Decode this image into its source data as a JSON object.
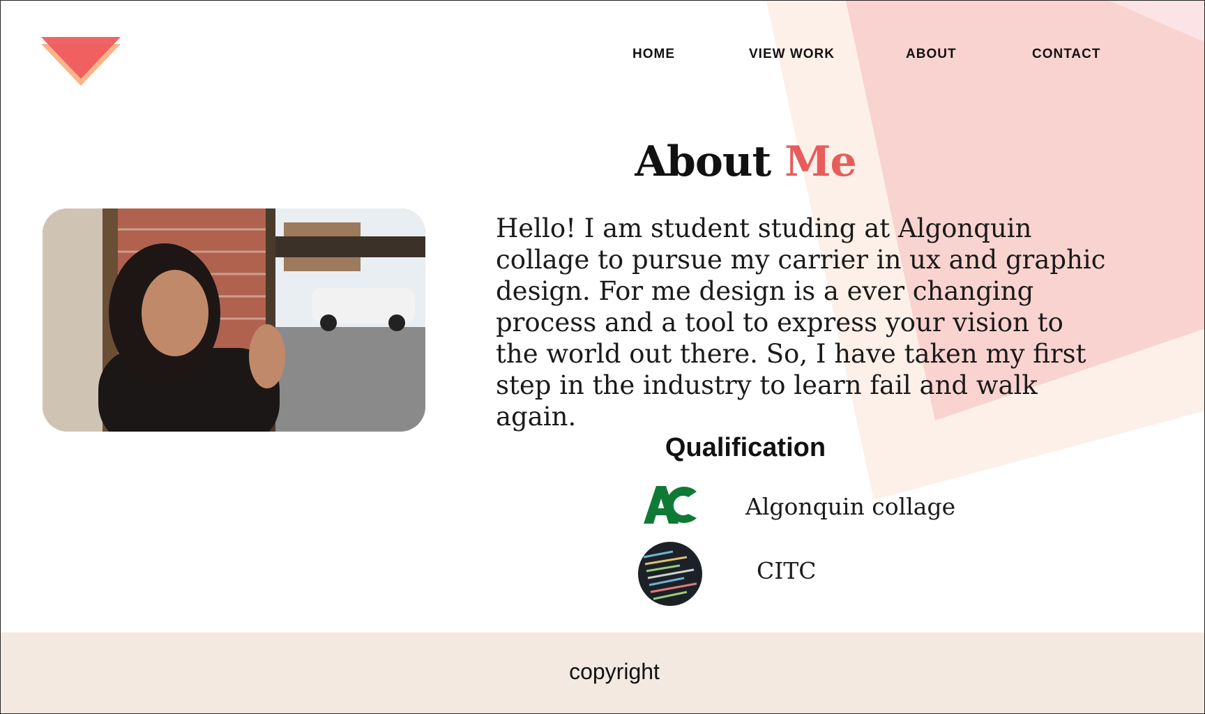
{
  "nav": {
    "items": [
      "HOME",
      "VIEW WORK",
      "ABOUT",
      "CONTACT"
    ]
  },
  "hero": {
    "title_part1": "About",
    "title_part2": "Me"
  },
  "bio": {
    "text": "Hello!  I am student studing at Algonquin collage to pursue my carrier in ux and graphic design.  For me design is a ever changing process and a tool to express your vision to the world out there. So, I have taken my first step in the industry to learn fail and walk again."
  },
  "qualification": {
    "heading": "Qualification",
    "items": [
      {
        "name": "Algonquin collage",
        "icon": "algonquin-college-logo"
      },
      {
        "name": "CITC",
        "icon": "code-screen-icon"
      }
    ]
  },
  "footer": {
    "text": "copyright"
  },
  "colors": {
    "accent": "#e85c5c",
    "logo_top": "#ef5c5e",
    "logo_bottom": "#f9b48c",
    "bg_shape_light": "#fdf0e8",
    "bg_shape_pink": "#f9d3cf",
    "footer_bg": "#f3e9e0",
    "ac_green": "#0f7a36"
  }
}
